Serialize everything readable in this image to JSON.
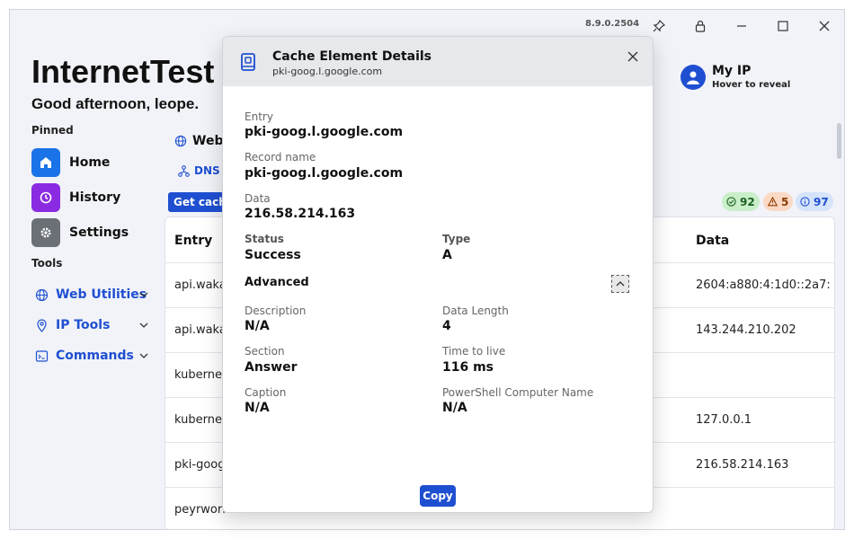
{
  "app": {
    "version": "8.9.0.2504",
    "title": "InternetTest",
    "greeting": "Good afternoon, leope."
  },
  "sidebar": {
    "pinned_label": "Pinned",
    "pinned": [
      {
        "label": "Home",
        "icon": "home-icon",
        "color": "#1a73e8"
      },
      {
        "label": "History",
        "icon": "history-icon",
        "color": "#8a2be2"
      },
      {
        "label": "Settings",
        "icon": "gear-icon",
        "color": "#6b6f76"
      }
    ],
    "tools_label": "Tools",
    "tools": [
      {
        "label": "Web Utilities",
        "icon": "globe-icon"
      },
      {
        "label": "IP Tools",
        "icon": "location-pin-icon"
      },
      {
        "label": "Commands",
        "icon": "terminal-icon"
      }
    ]
  },
  "myip": {
    "title": "My IP",
    "subtitle": "Hover to reveal"
  },
  "main": {
    "section_title": "Web Utilities",
    "tab_dns": "DNS",
    "get_cache_button": "Get cache",
    "badges": {
      "success": "92",
      "warning": "5",
      "info": "97"
    },
    "table": {
      "headers": {
        "entry": "Entry",
        "data": "Data"
      },
      "rows": [
        {
          "entry": "api.wakatime.com",
          "data": "2604:a880:4:1d0::2a7:"
        },
        {
          "entry": "api.wakatime.com",
          "data": "143.244.210.202"
        },
        {
          "entry": "kubernetes.docker.internal",
          "data": ""
        },
        {
          "entry": "kubernetes.docker.internal",
          "data": "127.0.0.1"
        },
        {
          "entry": "pki-goog.l.google.com",
          "data": "216.58.214.163"
        },
        {
          "entry": "peyrworld",
          "data": ""
        }
      ]
    }
  },
  "modal": {
    "title": "Cache Element Details",
    "subtitle": "pki-goog.l.google.com",
    "fields": {
      "entry_label": "Entry",
      "entry_value": "pki-goog.l.google.com",
      "record_name_label": "Record name",
      "record_name_value": "pki-goog.l.google.com",
      "data_label": "Data",
      "data_value": "216.58.214.163",
      "status_label": "Status",
      "status_value": "Success",
      "type_label": "Type",
      "type_value": "A"
    },
    "advanced_label": "Advanced",
    "advanced": {
      "description_label": "Description",
      "description_value": "N/A",
      "data_length_label": "Data Length",
      "data_length_value": "4",
      "section_label": "Section",
      "section_value": "Answer",
      "ttl_label": "Time to live",
      "ttl_value": "116 ms",
      "caption_label": "Caption",
      "caption_value": "N/A",
      "ps_computer_label": "PowerShell Computer Name",
      "ps_computer_value": "N/A"
    },
    "copy_button": "Copy"
  },
  "colors": {
    "accent": "#1f4fd1",
    "success_bg": "#c9efc9",
    "warning_bg": "#fbd9c4",
    "info_bg": "#d5e3fb"
  }
}
